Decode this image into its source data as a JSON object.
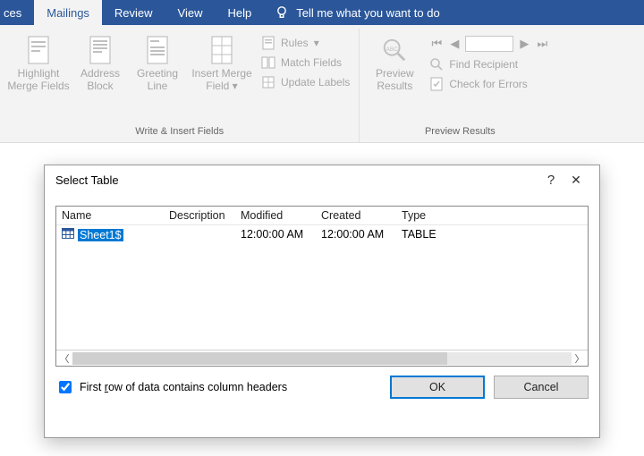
{
  "tabs": {
    "cut": "ces",
    "mailings": "Mailings",
    "review": "Review",
    "view": "View",
    "help": "Help",
    "tellme": "Tell me what you want to do"
  },
  "ribbon": {
    "write_insert": {
      "highlight1": "Highlight",
      "highlight2": "Merge Fields",
      "address1": "Address",
      "address2": "Block",
      "greeting1": "Greeting",
      "greeting2": "Line",
      "insert1": "Insert Merge",
      "insert2": "Field",
      "rules": "Rules",
      "match": "Match Fields",
      "update": "Update Labels",
      "caption": "Write & Insert Fields"
    },
    "preview": {
      "big1": "Preview",
      "big2": "Results",
      "find": "Find Recipient",
      "check": "Check for Errors",
      "caption": "Preview Results"
    }
  },
  "dialog": {
    "title": "Select Table",
    "columns": {
      "name": "Name",
      "description": "Description",
      "modified": "Modified",
      "created": "Created",
      "type": "Type"
    },
    "rows": [
      {
        "name": "Sheet1$",
        "description": "",
        "modified": "12:00:00 AM",
        "created": "12:00:00 AM",
        "type": "TABLE"
      }
    ],
    "checkbox_prefix": "First ",
    "checkbox_underline": "r",
    "checkbox_suffix": "ow of data contains column headers",
    "checkbox_checked": true,
    "ok": "OK",
    "cancel": "Cancel",
    "help": "?",
    "close": "✕"
  }
}
